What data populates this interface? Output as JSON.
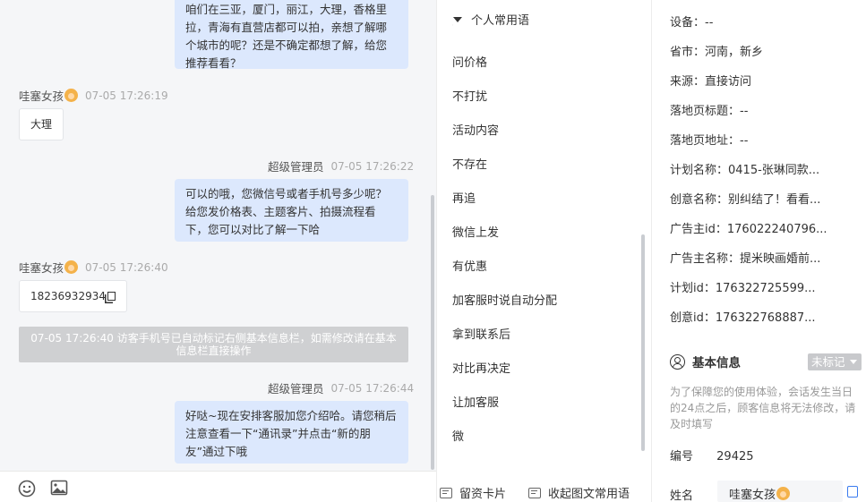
{
  "chat": {
    "messages": [
      {
        "text": "咱们在三亚，厦门，丽江，大理，香格里拉，青海有直营店都可以拍，亲想了解哪个城市的呢？还是不确定都想了解，给您推荐看看？"
      },
      {
        "sender": "哇塞女孩",
        "time": "07-05 17:26:19",
        "text": "大理"
      },
      {
        "sender": "超级管理员",
        "time": "07-05 17:26:22",
        "text": "可以的哦，您微信号或者手机号多少呢？给您发价格表、主题客片、拍摄流程看下，您可以对比了解一下哈"
      },
      {
        "sender": "哇塞女孩",
        "time": "07-05 17:26:40",
        "text": "18236932934"
      },
      {
        "sender": "超级管理员",
        "time": "07-05 17:26:44",
        "text": "好哒~现在安排客服加您介绍哈。请您稍后注意查看一下“通讯录”并点击“新的朋友”通过下哦"
      }
    ],
    "system_notice": "07-05 17:26:40 访客手机号已自动标记右侧基本信息栏，如需修改请在基本信息栏直接操作"
  },
  "phrases": {
    "header": "个人常用语",
    "items": [
      "问价格",
      "不打扰",
      "活动内容",
      "不存在",
      "再追",
      "微信上发",
      "有优惠",
      "加客服时说自动分配",
      "拿到联系后",
      "对比再决定",
      "让加客服",
      "微"
    ],
    "footer_card": "留资卡片",
    "footer_collapse": "收起图文常用语"
  },
  "info": {
    "rows": [
      {
        "label": "设备：",
        "value": "--"
      },
      {
        "label": "省市：",
        "value": "河南，新乡"
      },
      {
        "label": "来源：",
        "value": "直接访问"
      },
      {
        "label": "落地页标题：",
        "value": "--"
      },
      {
        "label": "落地页地址：",
        "value": "--"
      },
      {
        "label": "计划名称：",
        "value": "0415-张琳同款..."
      },
      {
        "label": "创意名称：",
        "value": "别纠结了！看看..."
      },
      {
        "label": "广告主id：",
        "value": "176022240796..."
      },
      {
        "label": "广告主名称：",
        "value": "提米映画婚前..."
      },
      {
        "label": "计划id：",
        "value": "176322725599..."
      },
      {
        "label": "创意id：",
        "value": "176322768887..."
      }
    ],
    "basic_title": "基本信息",
    "tag_label": "未标记",
    "note": "为了保障您的使用体验，会话发生当日的24点之后，顾客信息将无法修改，请及时填写",
    "id_label": "编号",
    "id_value": "29425",
    "name_label": "姓名",
    "name_value": "哇塞女孩"
  }
}
